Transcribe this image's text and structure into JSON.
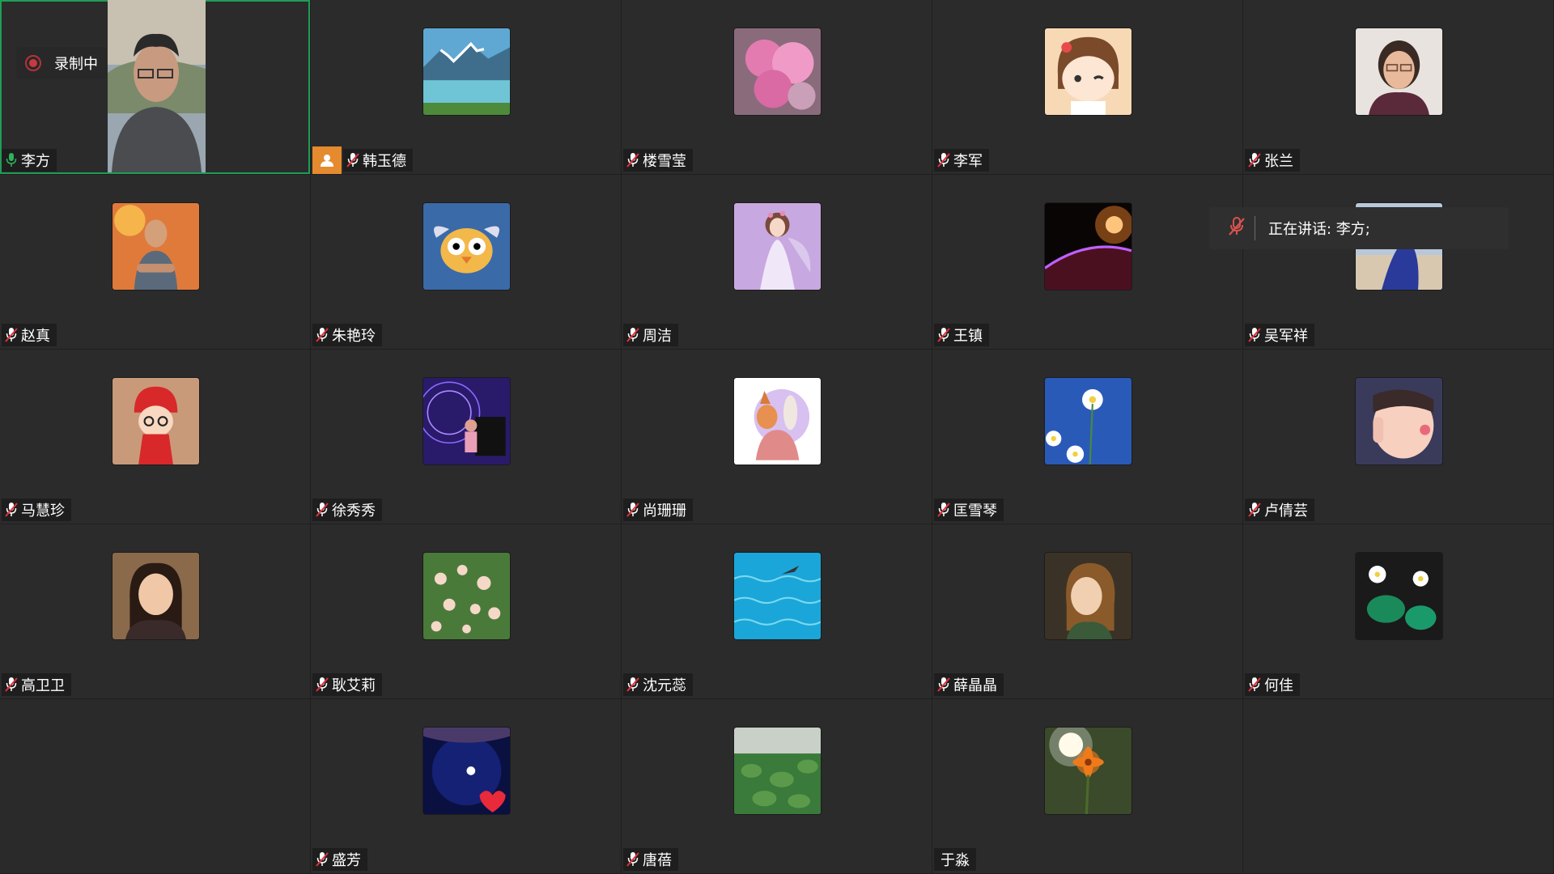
{
  "recording": {
    "label": "录制中"
  },
  "speaking": {
    "label": "正在讲话: 李方;"
  },
  "participants": [
    {
      "name": "李方",
      "mic": "on",
      "video": true,
      "active": true
    },
    {
      "name": "韩玉德",
      "mic": "muted",
      "host": true,
      "avatar": "lake-mountains"
    },
    {
      "name": "楼雪莹",
      "mic": "muted",
      "avatar": "pink-peony"
    },
    {
      "name": "李军",
      "mic": "muted",
      "avatar": "cartoon-girl-wink"
    },
    {
      "name": "张兰",
      "mic": "muted",
      "avatar": "woman-glasses-portrait"
    },
    {
      "name": "赵真",
      "mic": "muted",
      "avatar": "man-crossed-arms"
    },
    {
      "name": "朱艳玲",
      "mic": "muted",
      "avatar": "cartoon-bird"
    },
    {
      "name": "周洁",
      "mic": "muted",
      "avatar": "flower-fairy"
    },
    {
      "name": "王镇",
      "mic": "muted",
      "avatar": "planet-sunrise"
    },
    {
      "name": "吴军祥",
      "mic": "muted",
      "avatar": "blue-dress"
    },
    {
      "name": "马慧珍",
      "mic": "muted",
      "avatar": "knitted-doll"
    },
    {
      "name": "徐秀秀",
      "mic": "muted",
      "avatar": "piano-girl"
    },
    {
      "name": "尚珊珊",
      "mic": "muted",
      "avatar": "fox-rabbit-drawing"
    },
    {
      "name": "匡雪琴",
      "mic": "muted",
      "avatar": "daisies-sky"
    },
    {
      "name": "卢倩芸",
      "mic": "muted",
      "avatar": "child-peace-sign"
    },
    {
      "name": "高卫卫",
      "mic": "muted",
      "avatar": "woman-selfie"
    },
    {
      "name": "耿艾莉",
      "mic": "muted",
      "avatar": "rose-bush"
    },
    {
      "name": "沈元蕊",
      "mic": "muted",
      "avatar": "blue-sea"
    },
    {
      "name": "薛晶晶",
      "mic": "muted",
      "avatar": "painted-girl"
    },
    {
      "name": "何佳",
      "mic": "muted",
      "avatar": "lotus-painting"
    },
    {
      "name": "",
      "empty": true
    },
    {
      "name": "盛芳",
      "mic": "muted",
      "avatar": "space-heart-flag"
    },
    {
      "name": "唐蓓",
      "mic": "muted",
      "avatar": "lotus-pond"
    },
    {
      "name": "于淼",
      "mic": "none",
      "avatar": "orange-flower-sun"
    },
    {
      "name": "",
      "empty": true
    }
  ],
  "colors": {
    "background": "#262626",
    "tile": "#2b2b2b",
    "active_border": "#1f9d55",
    "host_badge": "#e58a2e",
    "recording": "#c73a41"
  }
}
